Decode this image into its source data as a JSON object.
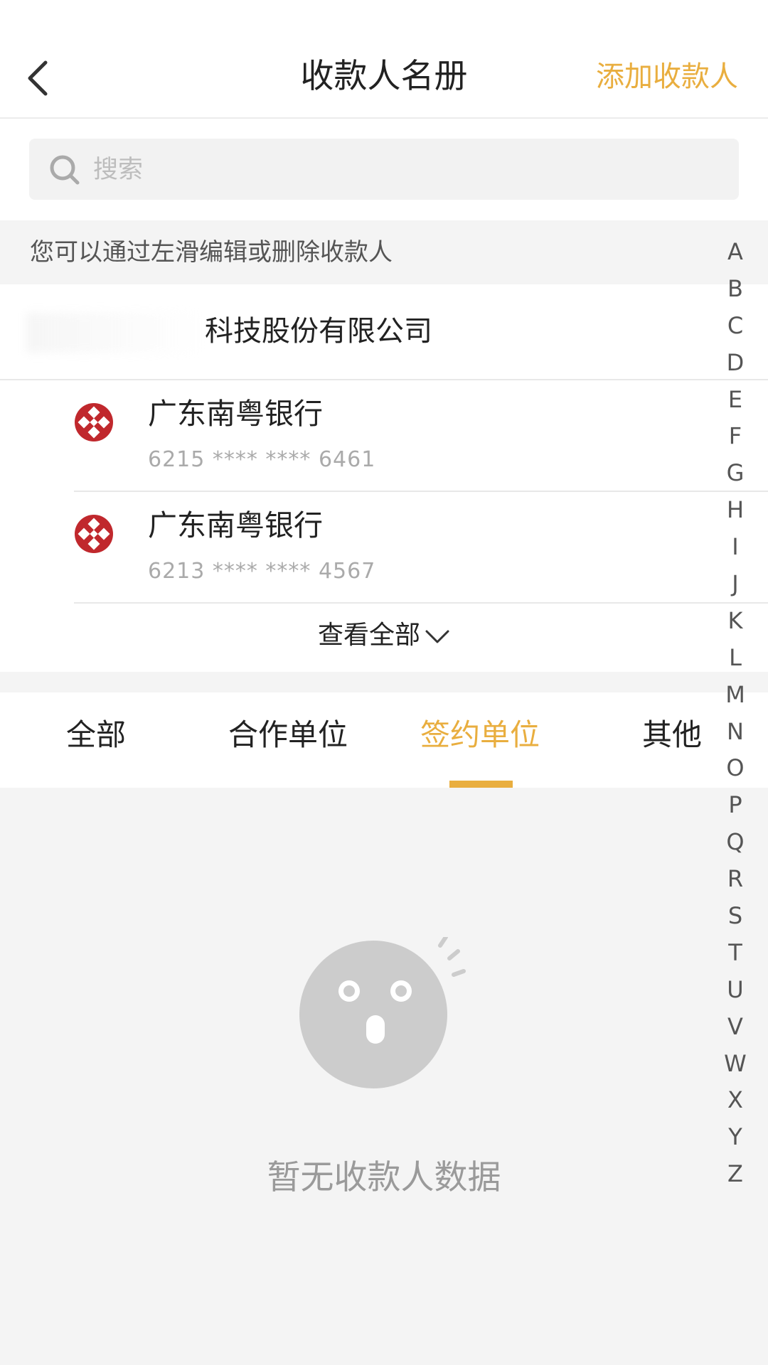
{
  "nav": {
    "title": "收款人名册",
    "action_label": "添加收款人"
  },
  "search": {
    "placeholder": "搜索"
  },
  "hint": "您可以通过左滑编辑或删除收款人",
  "payee": {
    "company_name": "科技股份有限公司",
    "accounts": [
      {
        "bank": "广东南粤银行",
        "number": "6215 **** **** 6461"
      },
      {
        "bank": "广东南粤银行",
        "number": "6213 **** **** 4567"
      }
    ],
    "view_all_label": "查看全部"
  },
  "tabs": [
    {
      "label": "全部",
      "active": false
    },
    {
      "label": "合作单位",
      "active": false
    },
    {
      "label": "签约单位",
      "active": true
    },
    {
      "label": "其他",
      "active": false
    }
  ],
  "empty_state": {
    "message": "暂无收款人数据"
  },
  "alphabet": [
    "A",
    "B",
    "C",
    "D",
    "E",
    "F",
    "G",
    "H",
    "I",
    "J",
    "K",
    "L",
    "M",
    "N",
    "O",
    "P",
    "Q",
    "R",
    "S",
    "T",
    "U",
    "V",
    "W",
    "X",
    "Y",
    "Z"
  ],
  "colors": {
    "accent": "#e9ae3f",
    "bank_logo": "#c0282d",
    "empty_icon": "#cccccc"
  }
}
